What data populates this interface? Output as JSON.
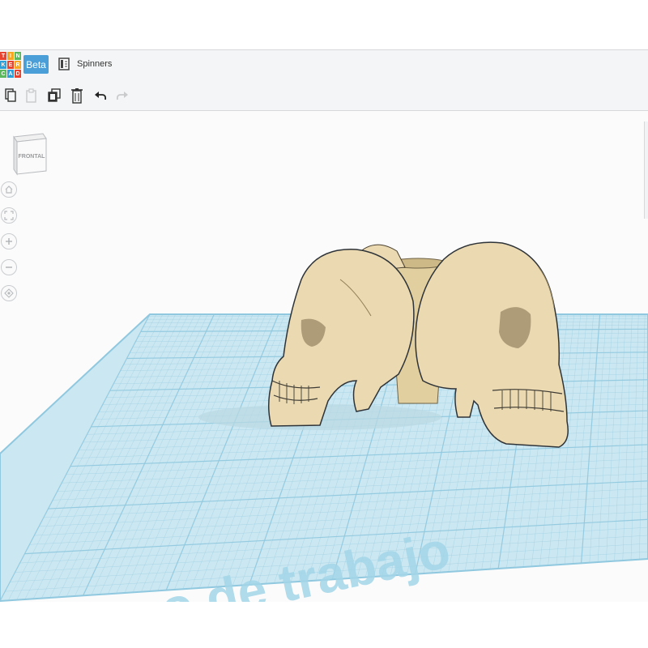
{
  "app": {
    "logo_letters": [
      "T",
      "I",
      "N",
      "K",
      "E",
      "R",
      "C",
      "A",
      "D"
    ],
    "logo_colors": [
      "#e84230",
      "#f6a623",
      "#5cb85c",
      "#2d9fd9",
      "#e84230",
      "#f6a623",
      "#5cb85c",
      "#2d9fd9",
      "#e84230"
    ],
    "beta_label": "Beta",
    "beta_color": "#4a9fd8",
    "project_title": "Spinners"
  },
  "toolbar": {
    "buttons": [
      {
        "name": "copy-icon",
        "enabled": true
      },
      {
        "name": "paste-icon",
        "enabled": false
      },
      {
        "name": "duplicate-icon",
        "enabled": true
      },
      {
        "name": "delete-icon",
        "enabled": true
      },
      {
        "name": "undo-icon",
        "enabled": true
      },
      {
        "name": "redo-icon",
        "enabled": false
      }
    ]
  },
  "view": {
    "viewcube_label": "FRONTAL",
    "nav_buttons": [
      "home-view-icon",
      "fit-view-icon",
      "zoom-in-icon",
      "zoom-out-icon",
      "orthographic-icon"
    ]
  },
  "workplane": {
    "label": "Plano de trabajo",
    "grid_color": "#8fc8df",
    "plane_color": "#cbe7f1",
    "model_color": "#ead9b1"
  }
}
